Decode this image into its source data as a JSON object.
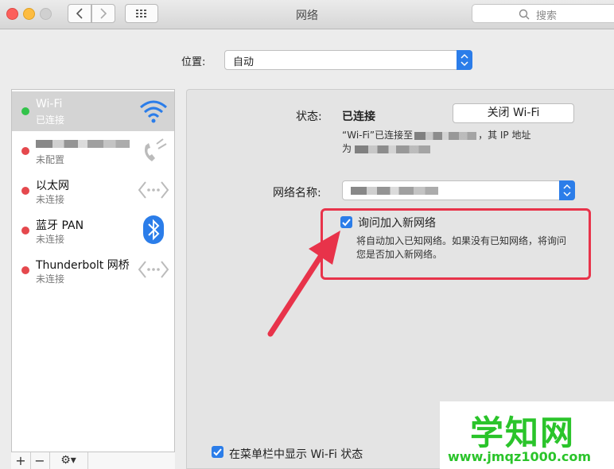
{
  "window": {
    "title": "网络"
  },
  "search": {
    "placeholder": "搜索"
  },
  "location": {
    "label": "位置:",
    "value": "自动"
  },
  "services": [
    {
      "name": "Wi-Fi",
      "status": "已连接",
      "dot": "green",
      "icon": "wifi-icon"
    },
    {
      "name": "",
      "status": "未配置",
      "dot": "red",
      "icon": "phone-icon"
    },
    {
      "name": "以太网",
      "status": "未连接",
      "dot": "red",
      "icon": "ethernet-icon"
    },
    {
      "name": "蓝牙 PAN",
      "status": "未连接",
      "dot": "red",
      "icon": "bluetooth-icon"
    },
    {
      "name": "Thunderbolt 网桥",
      "status": "未连接",
      "dot": "red",
      "icon": "ethernet-icon"
    }
  ],
  "sidebar_toolbar": {
    "add": "+",
    "remove": "−",
    "gear": "⚙▾"
  },
  "detail": {
    "status_label": "状态:",
    "status_value": "已连接",
    "toggle_wifi_label": "关闭 Wi-Fi",
    "desc_line1_start": "“Wi-Fi”已连接至",
    "desc_line1_end": "，其 IP 地址",
    "desc_line2_start": "为",
    "network_name_label": "网络名称:",
    "ask_join_label": "询问加入新网络",
    "ask_join_desc_line1": "将自动加入已知网络。如果没有已知网络，将询问",
    "ask_join_desc_line2": "您是否加入新网络。",
    "show_in_menubar_label": "在菜单栏中显示 Wi-Fi 状态"
  },
  "watermark": {
    "main": "学知网",
    "sub": "www.jmqz1000.com"
  },
  "colors": {
    "accent": "#2b7de9",
    "highlight": "#e8334a",
    "connected": "#32c34a",
    "disconnected": "#e5484d"
  }
}
